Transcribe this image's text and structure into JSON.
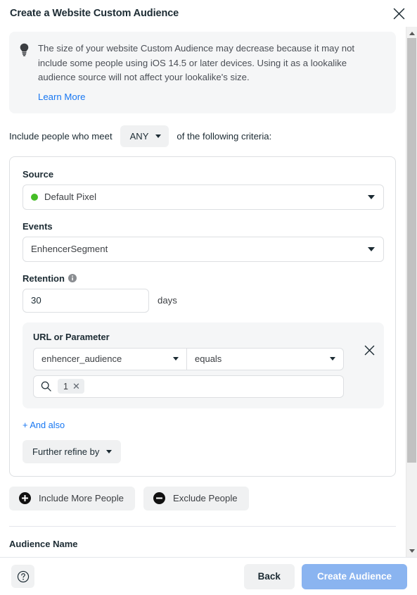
{
  "dialog": {
    "title": "Create a Website Custom Audience",
    "close_label": "close-icon"
  },
  "notice": {
    "icon": "lightbulb-icon",
    "text": "The size of your website Custom Audience may decrease because it may not include some people using iOS 14.5 or later devices. Using it as a lookalike audience source will not affect your lookalike's size.",
    "link": "Learn More"
  },
  "criteria": {
    "prefix": "Include people who meet",
    "match": "ANY",
    "suffix": "of the following criteria:"
  },
  "card": {
    "source": {
      "label": "Source",
      "value": "Default Pixel",
      "dot_color": "#45bd26"
    },
    "events": {
      "label": "Events",
      "value": "EnhencerSegment"
    },
    "retention": {
      "label": "Retention",
      "info_icon": "info-icon",
      "value": "30",
      "placeholder": "30",
      "unit": "days"
    },
    "rule": {
      "label": "URL or Parameter",
      "parameter": "enhencer_audience",
      "operator": "equals",
      "search_icon": "search-icon",
      "value_tokens": [
        "1"
      ],
      "remove_label": "close-icon"
    },
    "and_also": "+ And also",
    "further_refine": "Further refine by"
  },
  "actions": {
    "include": "Include More People",
    "exclude": "Exclude People"
  },
  "audience_name": {
    "label": "Audience Name"
  },
  "footer": {
    "help": "help-icon",
    "back": "Back",
    "create": "Create Audience",
    "create_color": "#8ab4f0"
  },
  "scrollbar": {
    "up": "chevron-up-icon",
    "down": "chevron-down-icon"
  }
}
